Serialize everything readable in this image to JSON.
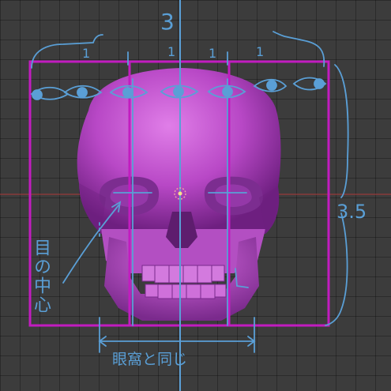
{
  "annotations": {
    "top_total": "3",
    "unit_marks": [
      "1",
      "1",
      "1",
      "1"
    ],
    "height_ratio": "3.5",
    "eye_center_label": "目の中心",
    "bottom_note": "眼窩と同じ"
  },
  "colors": {
    "guide_frame": "#c21cc0",
    "ink": "#5a9fd6",
    "skull": "#c45ad4",
    "x_axis": "#a83a3a",
    "background": "#3c3c3c"
  },
  "icons": {
    "eye_row": "eye-icon",
    "pivot": "origin-pivot-icon"
  }
}
